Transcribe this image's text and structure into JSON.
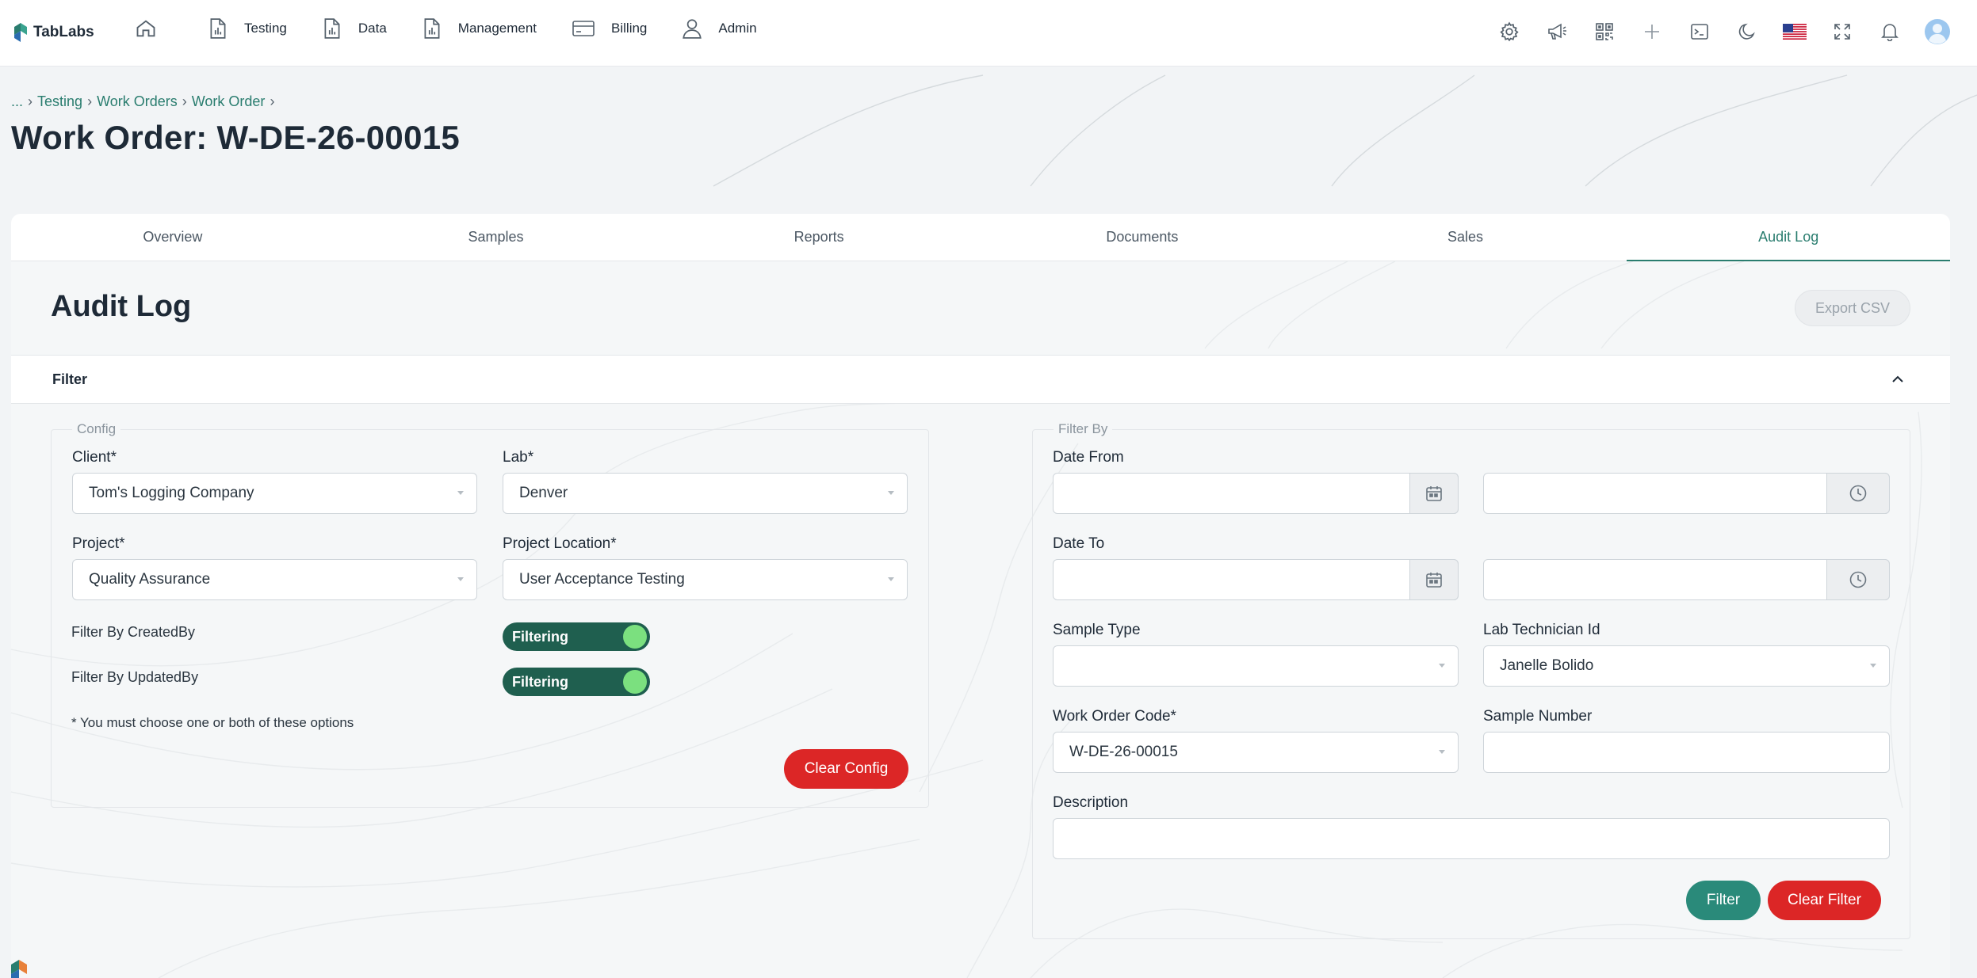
{
  "app": {
    "name": "TabLabs"
  },
  "colors": {
    "accent": "#2a7d6f",
    "danger": "#dc2626",
    "toggle_on": "#1f5f4f"
  },
  "nav": {
    "items": [
      {
        "label": "",
        "icon": "home-icon"
      },
      {
        "label": "Testing",
        "icon": "document-chart-icon"
      },
      {
        "label": "Data",
        "icon": "document-chart-icon"
      },
      {
        "label": "Management",
        "icon": "document-chart-icon"
      },
      {
        "label": "Billing",
        "icon": "credit-card-icon"
      },
      {
        "label": "Admin",
        "icon": "user-icon"
      }
    ],
    "tools": [
      "gear-icon",
      "megaphone-icon",
      "qr-code-icon",
      "plus-icon",
      "terminal-icon",
      "moon-icon",
      "us-flag-icon",
      "fullscreen-icon",
      "bell-icon",
      "avatar-icon"
    ]
  },
  "breadcrumb": {
    "root": "...",
    "items": [
      "Testing",
      "Work Orders",
      "Work Order"
    ]
  },
  "page": {
    "title": "Work Order: W-DE-26-00015"
  },
  "tabs": [
    {
      "label": "Overview",
      "active": false
    },
    {
      "label": "Samples",
      "active": false
    },
    {
      "label": "Reports",
      "active": false
    },
    {
      "label": "Documents",
      "active": false
    },
    {
      "label": "Sales",
      "active": false
    },
    {
      "label": "Audit Log",
      "active": true
    }
  ],
  "audit": {
    "title": "Audit Log",
    "export_label": "Export CSV"
  },
  "filter": {
    "header": "Filter",
    "config": {
      "legend": "Config",
      "client": {
        "label": "Client*",
        "value": "Tom's Logging Company"
      },
      "lab": {
        "label": "Lab*",
        "value": "Denver"
      },
      "project": {
        "label": "Project*",
        "value": "Quality Assurance"
      },
      "project_location": {
        "label": "Project Location*",
        "value": "User Acceptance Testing"
      },
      "created_by": {
        "label": "Filter By CreatedBy",
        "toggle": "Filtering"
      },
      "updated_by": {
        "label": "Filter By UpdatedBy",
        "toggle": "Filtering"
      },
      "note": "* You must choose one or both of these options",
      "clear_label": "Clear Config"
    },
    "filter_by": {
      "legend": "Filter By",
      "date_from": {
        "label": "Date From",
        "date": "",
        "time": ""
      },
      "date_to": {
        "label": "Date To",
        "date": "",
        "time": ""
      },
      "sample_type": {
        "label": "Sample Type",
        "value": ""
      },
      "lab_technician": {
        "label": "Lab Technician Id",
        "value": "Janelle Bolido"
      },
      "work_order_code": {
        "label": "Work Order Code*",
        "value": "W-DE-26-00015"
      },
      "sample_number": {
        "label": "Sample Number",
        "value": ""
      },
      "description": {
        "label": "Description",
        "value": ""
      },
      "filter_label": "Filter",
      "clear_label": "Clear Filter"
    }
  }
}
